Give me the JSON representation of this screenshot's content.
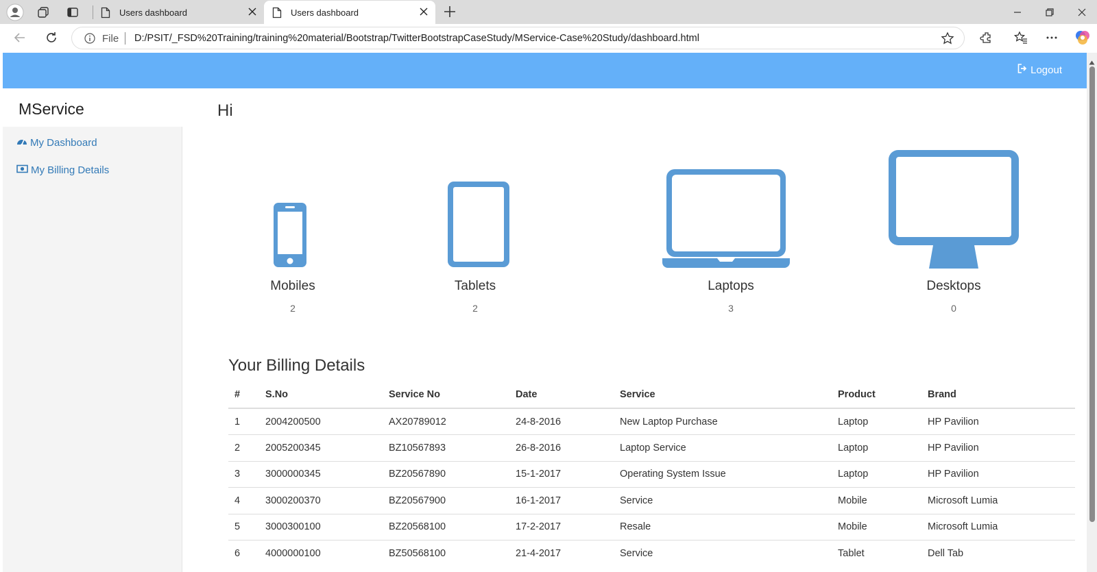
{
  "browser": {
    "tabs": [
      {
        "title": "Users dashboard",
        "active": false
      },
      {
        "title": "Users dashboard",
        "active": true
      }
    ],
    "address": {
      "scheme_label": "File",
      "url": "D:/PSIT/_FSD%20Training/training%20material/Bootstrap/TwitterBootstrapCaseStudy/MService-Case%20Study/dashboard.html"
    }
  },
  "navbar": {
    "logout_label": "Logout",
    "bg_color": "#64b0f9"
  },
  "sidebar": {
    "brand": "MService",
    "items": [
      {
        "label": "My Dashboard",
        "icon": "dashboard-icon"
      },
      {
        "label": "My Billing Details",
        "icon": "money-icon"
      }
    ]
  },
  "main": {
    "greeting": "Hi",
    "devices": [
      {
        "label": "Mobiles",
        "count": "2",
        "icon": "mobile-icon"
      },
      {
        "label": "Tablets",
        "count": "2",
        "icon": "tablet-icon"
      },
      {
        "label": "Laptops",
        "count": "3",
        "icon": "laptop-icon"
      },
      {
        "label": "Desktops",
        "count": "0",
        "icon": "desktop-icon"
      }
    ],
    "icon_color": "#5a9bd5",
    "billing": {
      "title": "Your Billing Details",
      "columns": [
        "#",
        "S.No",
        "Service No",
        "Date",
        "Service",
        "Product",
        "Brand"
      ],
      "rows": [
        [
          "1",
          "2004200500",
          "AX20789012",
          "24-8-2016",
          "New Laptop Purchase",
          "Laptop",
          "HP Pavilion"
        ],
        [
          "2",
          "2005200345",
          "BZ10567893",
          "26-8-2016",
          "Laptop Service",
          "Laptop",
          "HP Pavilion"
        ],
        [
          "3",
          "3000000345",
          "BZ20567890",
          "15-1-2017",
          "Operating System Issue",
          "Laptop",
          "HP Pavilion"
        ],
        [
          "4",
          "3000200370",
          "BZ20567900",
          "16-1-2017",
          "Service",
          "Mobile",
          "Microsoft Lumia"
        ],
        [
          "5",
          "3000300100",
          "BZ20568100",
          "17-2-2017",
          "Resale",
          "Mobile",
          "Microsoft Lumia"
        ],
        [
          "6",
          "4000000100",
          "BZ50568100",
          "21-4-2017",
          "Service",
          "Tablet",
          "Dell Tab"
        ]
      ]
    }
  }
}
